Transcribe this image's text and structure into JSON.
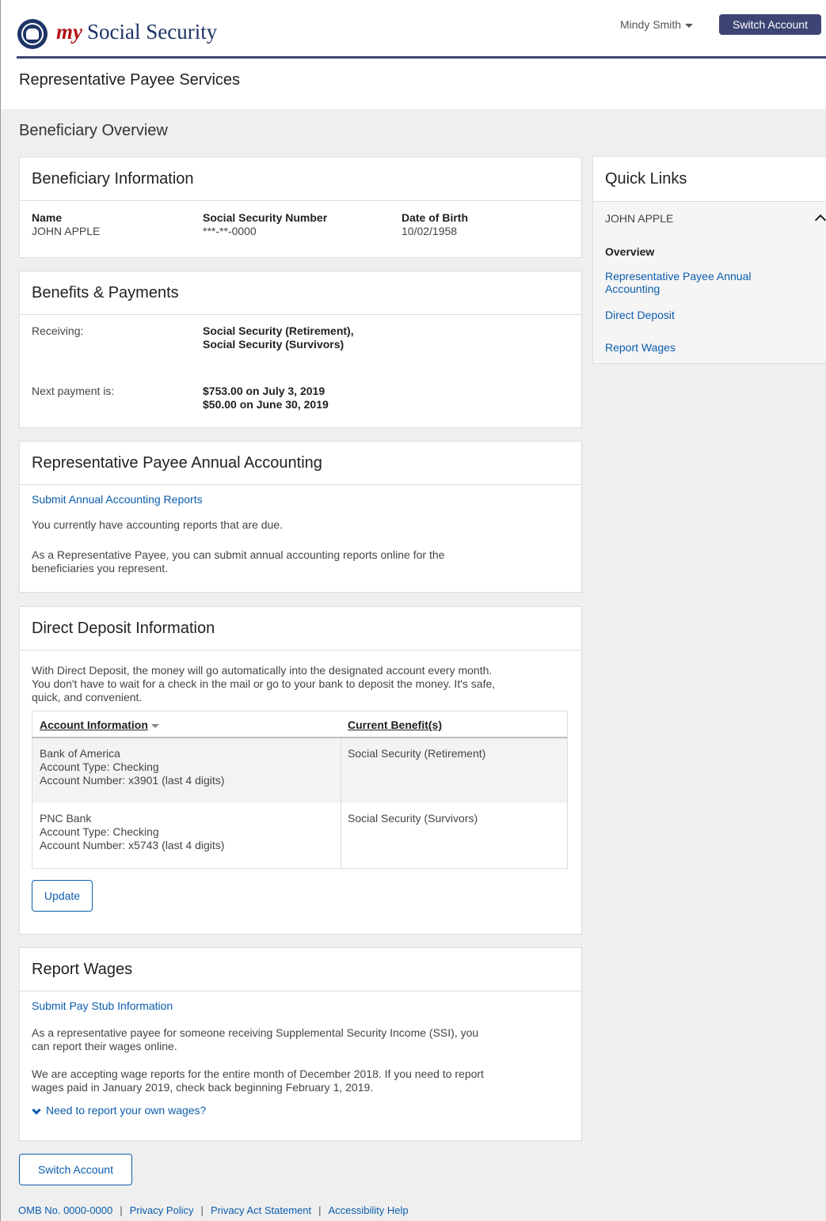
{
  "header": {
    "brand_my": "my",
    "brand_name": "Social Security",
    "user_name": "Mindy Smith",
    "switch_account": "Switch Account"
  },
  "page_title": "Representative Payee Services",
  "section_title": "Beneficiary Overview",
  "beneficiary_info": {
    "title": "Beneficiary Information",
    "name_label": "Name",
    "name_value": "JOHN APPLE",
    "ssn_label": "Social Security Number",
    "ssn_value": "***-**-0000",
    "dob_label": "Date of Birth",
    "dob_value": "10/02/1958"
  },
  "benefits": {
    "title": "Benefits & Payments",
    "receiving_label": "Receiving:",
    "receiving_line1": "Social Security (Retirement),",
    "receiving_line2": "Social Security (Survivors)",
    "next_label": "Next payment is:",
    "next_line1": "$753.00 on July 3, 2019",
    "next_line2": "$50.00 on June 30, 2019"
  },
  "annual_accounting": {
    "title": "Representative Payee Annual Accounting",
    "link": "Submit Annual Accounting Reports",
    "text1": "You currently have accounting reports that are due.",
    "text2_line1": "As a Representative Payee, you can submit annual accounting reports online for the",
    "text2_line2": "beneficiaries you represent."
  },
  "direct_deposit": {
    "title": "Direct Deposit Information",
    "intro_line1": "With Direct Deposit, the money will go automatically into the designated account every month.",
    "intro_line2": "You don't have to wait for a check in the mail or go to your bank to deposit the money. It's safe,",
    "intro_line3": "quick, and convenient.",
    "col1_header": "Account Information",
    "col2_header": "Current Benefit(s)",
    "rows": [
      {
        "bank": "Bank of America",
        "type": "Account Type: Checking",
        "number": "Account Number: x3901 (last 4 digits)",
        "benefit": "Social Security (Retirement)"
      },
      {
        "bank": "PNC Bank",
        "type": "Account Type: Checking",
        "number": "Account Number: x5743 (last 4 digits)",
        "benefit": "Social Security (Survivors)"
      }
    ],
    "update_button": "Update"
  },
  "report_wages": {
    "title": "Report Wages",
    "link": "Submit Pay Stub Information",
    "text1_line1": "As a representative payee for someone receiving Supplemental Security Income (SSI), you",
    "text1_line2": "can report their wages online.",
    "text2_line1": "We are accepting wage reports for the entire month of December 2018. If you need to report",
    "text2_line2": "wages paid in January 2019, check back beginning February 1, 2019.",
    "own_wages_link": "Need to report your own wages?"
  },
  "switch_account_button": "Switch Account",
  "quick_links": {
    "title": "Quick Links",
    "beneficiary": "JOHN APPLE",
    "overview": "Overview",
    "annual_line1": "Representative Payee Annual",
    "annual_line2": "Accounting",
    "direct_deposit": "Direct Deposit",
    "report_wages": "Report Wages"
  },
  "footer": {
    "omb": "OMB No. 0000-0000",
    "privacy_policy": "Privacy Policy",
    "privacy_act": "Privacy Act Statement",
    "accessibility": "Accessibility Help",
    "separator": "|"
  },
  "colors": {
    "navy": "#3d4574",
    "link": "#0b5cad",
    "brand_red": "#b31217",
    "gray_bg": "#efefef"
  }
}
